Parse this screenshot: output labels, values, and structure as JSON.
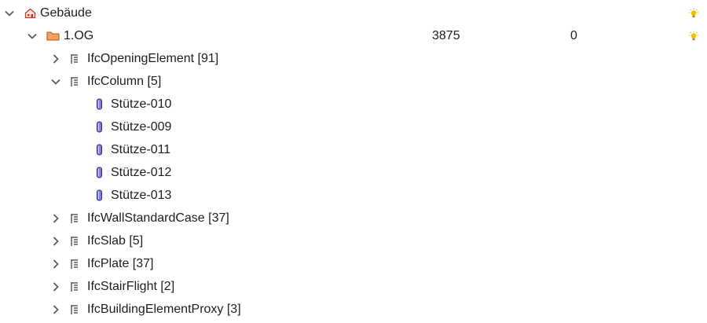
{
  "tree": {
    "root": {
      "label": "Gebäude",
      "expanded": true,
      "icon": "building-icon",
      "visibility_icon": "lightbulb-icon"
    },
    "storey": {
      "label": "1.OG",
      "expanded": true,
      "icon": "storey-icon",
      "value1": "3875",
      "value2": "0",
      "visibility_icon": "lightbulb-icon"
    },
    "groups": [
      {
        "label": "IfcOpeningElement [91]",
        "expanded": false,
        "icon": "ifc-type-icon"
      },
      {
        "label": "IfcColumn [5]",
        "expanded": true,
        "icon": "ifc-type-icon",
        "children": [
          {
            "label": "Stütze-010",
            "icon": "column-icon"
          },
          {
            "label": "Stütze-009",
            "icon": "column-icon"
          },
          {
            "label": "Stütze-011",
            "icon": "column-icon"
          },
          {
            "label": "Stütze-012",
            "icon": "column-icon"
          },
          {
            "label": "Stütze-013",
            "icon": "column-icon"
          }
        ]
      },
      {
        "label": "IfcWallStandardCase [37]",
        "expanded": false,
        "icon": "ifc-type-icon"
      },
      {
        "label": "IfcSlab [5]",
        "expanded": false,
        "icon": "ifc-type-icon"
      },
      {
        "label": "IfcPlate [37]",
        "expanded": false,
        "icon": "ifc-type-icon"
      },
      {
        "label": "IfcStairFlight [2]",
        "expanded": false,
        "icon": "ifc-type-icon"
      },
      {
        "label": "IfcBuildingElementProxy [3]",
        "expanded": false,
        "icon": "ifc-type-icon"
      }
    ]
  },
  "colors": {
    "text": "#1e1e1e",
    "chevron": "#5a5a5a",
    "building_icon": "#c0392b",
    "storey_icon": "#e07a2e",
    "column_icon": "#4a4aa8",
    "bulb": "#f2c200"
  }
}
